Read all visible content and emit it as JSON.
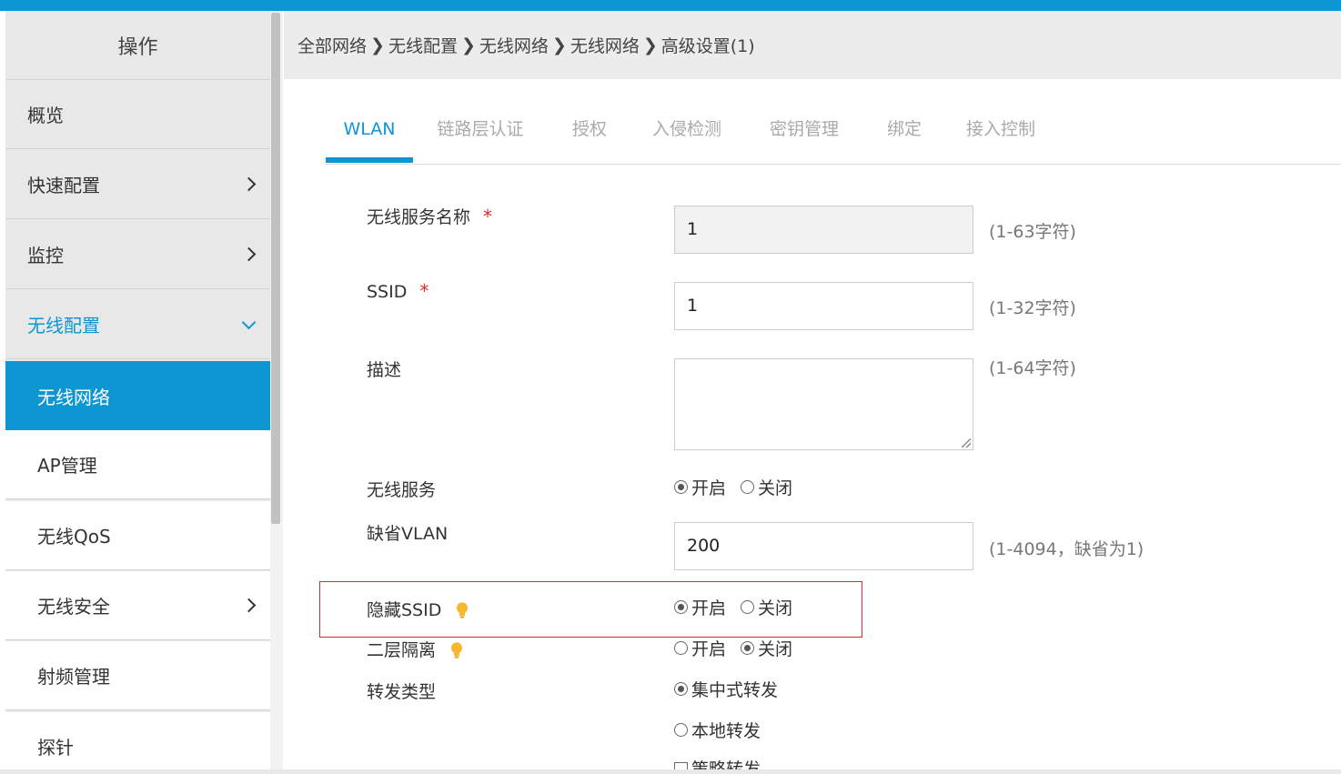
{
  "sidebar": {
    "header": "操作",
    "items": [
      {
        "label": "概览"
      },
      {
        "label": "快速配置"
      },
      {
        "label": "监控"
      },
      {
        "label": "无线配置"
      },
      {
        "label": "无线网络"
      },
      {
        "label": "AP管理"
      },
      {
        "label": "无线QoS"
      },
      {
        "label": "无线安全"
      },
      {
        "label": "射频管理"
      },
      {
        "label": "探针"
      }
    ]
  },
  "breadcrumb": {
    "items": [
      "全部网络",
      "无线配置",
      "无线网络",
      "无线网络",
      "高级设置(1)"
    ],
    "separator": "❯"
  },
  "tabs": [
    {
      "label": "WLAN",
      "active": true
    },
    {
      "label": "链路层认证"
    },
    {
      "label": "授权"
    },
    {
      "label": "入侵检测"
    },
    {
      "label": "密钥管理"
    },
    {
      "label": "绑定"
    },
    {
      "label": "接入控制"
    }
  ],
  "form": {
    "service_name": {
      "label": "无线服务名称",
      "required": "*",
      "value": "1",
      "hint": "(1-63字符)"
    },
    "ssid": {
      "label": "SSID",
      "required": "*",
      "value": "1",
      "hint": "(1-32字符)"
    },
    "description": {
      "label": "描述",
      "value": "",
      "hint": "(1-64字符)"
    },
    "wireless_service": {
      "label": "无线服务",
      "on": "开启",
      "off": "关闭",
      "selected": "on"
    },
    "default_vlan": {
      "label": "缺省VLAN",
      "value": "200",
      "hint": "(1-4094，缺省为1)"
    },
    "hide_ssid": {
      "label": "隐藏SSID",
      "on": "开启",
      "off": "关闭",
      "selected": "on"
    },
    "l2_isolation": {
      "label": "二层隔离",
      "on": "开启",
      "off": "关闭",
      "selected": "off"
    },
    "forward_type": {
      "label": "转发类型",
      "opt1": "集中式转发",
      "opt2": "本地转发",
      "opt3": "策略转发",
      "selected": "opt1"
    }
  },
  "colors": {
    "accent": "#0e96d3",
    "required": "#e0282c",
    "highlight_border": "#e02a2a",
    "bulb": "#f5b82e"
  }
}
